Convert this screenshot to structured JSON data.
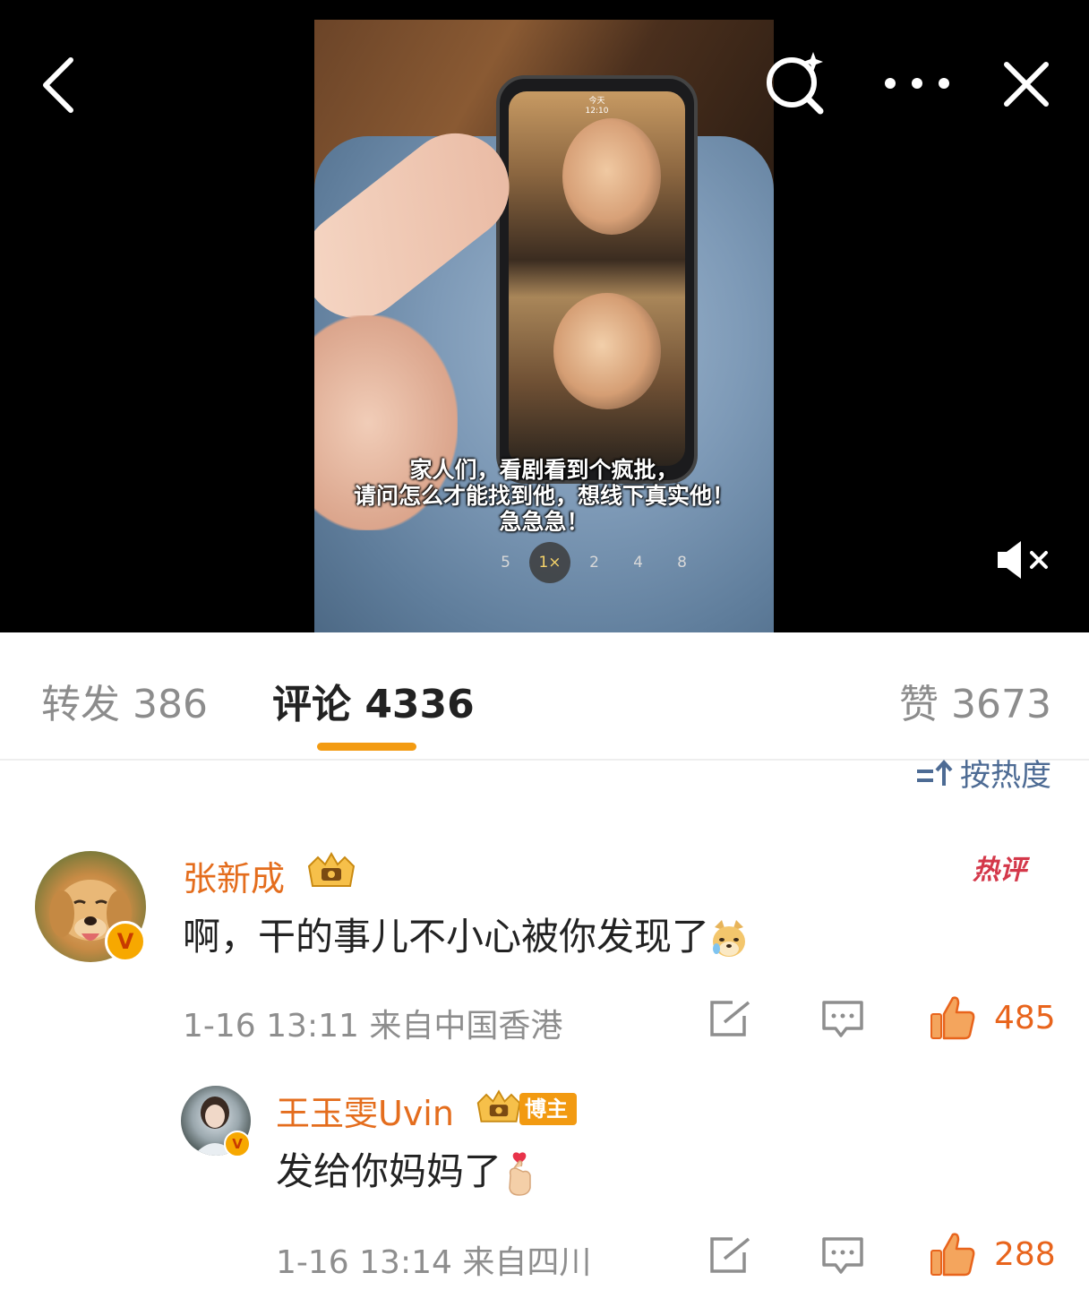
{
  "video": {
    "subtitle_line1": "家人们，看剧看到个疯批，",
    "subtitle_line2": "请问怎么才能找到他，想线下真实他！",
    "subtitle_line3": "急急急！",
    "speeds": [
      "5",
      "1×",
      "2",
      "4",
      "8"
    ],
    "active_speed": "1×",
    "phone_header": "今天",
    "phone_time": "12:10",
    "mute_state": "muted"
  },
  "toolbar": {
    "back_icon": "back-arrow-icon",
    "search_icon": "magic-search-icon",
    "more_icon": "more-dots-icon",
    "close_icon": "close-icon",
    "mute_icon": "speaker-muted-icon"
  },
  "tabs": {
    "repost": "转发 386",
    "comments": "评论 4336",
    "likes": "赞 3673",
    "active": "comments",
    "indicator_color": "#f39b12"
  },
  "sort": {
    "label": "按热度",
    "icon": "sort-arrows-icon"
  },
  "comments": [
    {
      "username": "张新成",
      "avatar": "golden-retriever-avatar",
      "verified": "V",
      "badge": "crown-badge-icon",
      "hot_label": "热评",
      "text": "啊，干的事儿不小心被你发现了",
      "emoji": "doge-emoji",
      "meta": "1-16 13:11 来自中国香港",
      "likes": "485"
    },
    {
      "username": "王玉雯Uvin",
      "avatar": "girl-avatar",
      "verified": "V",
      "badge": "crown-badge-icon",
      "tag": "博主",
      "text": "发给你妈妈了",
      "emoji": "finger-heart-emoji",
      "meta": "1-16 13:14 来自四川",
      "likes": "288"
    }
  ],
  "colors": {
    "username": "#e46d1d",
    "like": "#e8641c",
    "link": "#4d6b94",
    "hot": "#d4384a"
  }
}
